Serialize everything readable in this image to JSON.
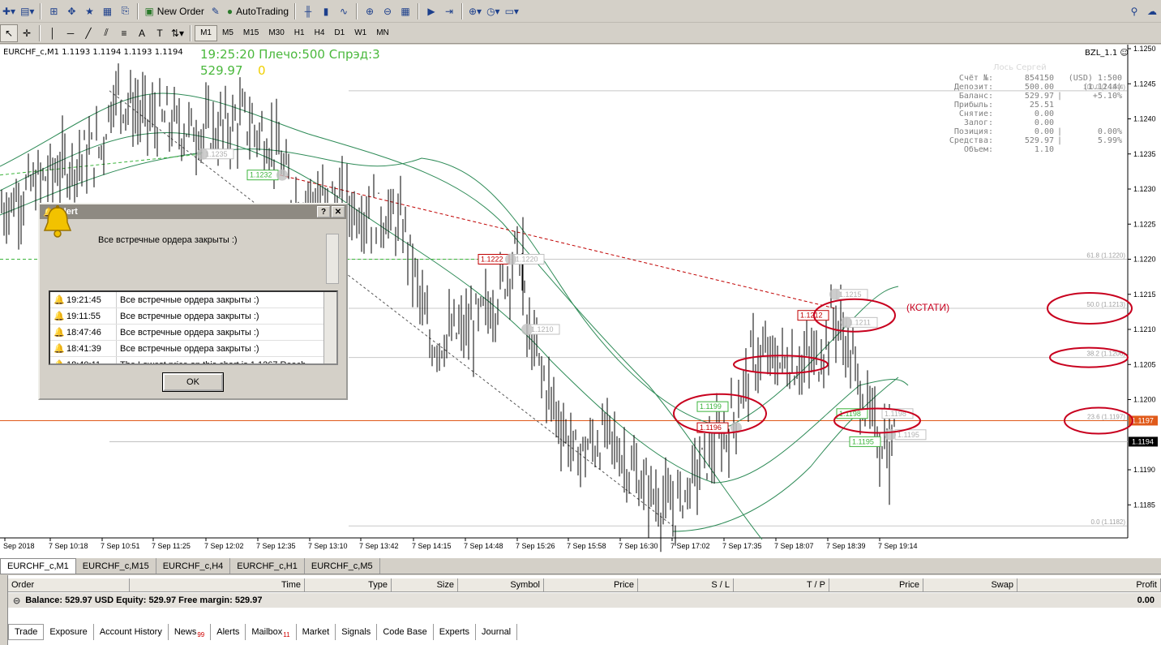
{
  "toolbar": {
    "new_order": "New Order",
    "autotrading": "AutoTrading",
    "timeframes": [
      "M1",
      "M5",
      "M15",
      "M30",
      "H1",
      "H4",
      "D1",
      "W1",
      "MN"
    ],
    "active_timeframe": "M1"
  },
  "chart": {
    "title": "EURCHF_c,M1  1.1193 1.1194 1.1193 1.1194",
    "clock_line": "19:25:20 Плечо:500 Спрэд:3",
    "balance_big": "529.97",
    "zero_big": "0",
    "indicator": "BZL_1.1",
    "annotation": "(КСТАТИ)",
    "price_labels": [
      "1.1250",
      "1.1245",
      "1.1240",
      "1.1235",
      "1.1230",
      "1.1225",
      "1.1220",
      "1.1215",
      "1.1210",
      "1.1205",
      "1.1200",
      "1.1197",
      "1.1194",
      "1.1190",
      "1.1185"
    ],
    "time_labels": [
      "Sep 2018",
      "7 Sep 10:18",
      "7 Sep 10:51",
      "7 Sep 11:25",
      "7 Sep 12:02",
      "7 Sep 12:35",
      "7 Sep 13:10",
      "7 Sep 13:42",
      "7 Sep 14:15",
      "7 Sep 14:48",
      "7 Sep 15:26",
      "7 Sep 15:58",
      "7 Sep 16:30",
      "7 Sep 17:02",
      "7 Sep 17:35",
      "7 Sep 18:07",
      "7 Sep 18:39",
      "7 Sep 19:14"
    ],
    "fib_labels": [
      "100.0 (1.1244)",
      "61.8 (1.1220)",
      "50.0 (1.1213)",
      "38.2 (1.1206)",
      "23.6 (1.1197)",
      "0.0 (1.1182)"
    ],
    "order_labels": [
      "1.1235",
      "1.1232",
      "1.1222",
      "1.1220",
      "1.1210",
      "1.1215",
      "1.1212",
      "1.1211",
      "1.1199",
      "1.1196",
      "1.1198",
      "1.1198",
      "1.1195",
      "1.1195"
    ]
  },
  "account": {
    "owner": "Лось Сергей",
    "rows": [
      {
        "k": "Счёт №:",
        "v": "854150",
        "s": "",
        "p": "(USD) 1:500"
      },
      {
        "k": "Депозит:",
        "v": "500.00",
        "s": "",
        "p": "(1.1244)"
      },
      {
        "k": "Баланс:",
        "v": "529.97",
        "s": "|",
        "p": "+5.10%"
      },
      {
        "k": "Прибыль:",
        "v": "25.51",
        "s": "",
        "p": ""
      },
      {
        "k": "Снятие:",
        "v": "0.00",
        "s": "",
        "p": ""
      },
      {
        "k": "Залог:",
        "v": "0.00",
        "s": "",
        "p": ""
      },
      {
        "k": "Позиция:",
        "v": "0.00",
        "s": "|",
        "p": "0.00%"
      },
      {
        "k": "Средства:",
        "v": "529.97",
        "s": "|",
        "p": "5.99%"
      },
      {
        "k": "Объем:",
        "v": "1.10",
        "s": "",
        "p": ""
      }
    ]
  },
  "alert": {
    "title": "Alert",
    "message": "Все встречные ордера закрыты :)",
    "rows": [
      {
        "time": "19:21:45",
        "msg": "Все встречные ордера закрыты :)"
      },
      {
        "time": "19:11:55",
        "msg": "Все встречные ордера закрыты :)"
      },
      {
        "time": "18:47:46",
        "msg": "Все встречные ордера закрыты :)"
      },
      {
        "time": "18:41:39",
        "msg": "Все встречные ордера закрыты :)"
      },
      {
        "time": "18:40:11",
        "msg": "The Lowest price on this chart is 1.1267 Reach"
      }
    ],
    "ok": "OK"
  },
  "chart_tabs": [
    "EURCHF_c,M1",
    "EURCHF_c,M15",
    "EURCHF_c,H4",
    "EURCHF_c,H1",
    "EURCHF_c,M5"
  ],
  "terminal": {
    "columns": [
      "Order",
      "Time",
      "Type",
      "Size",
      "Symbol",
      "Price",
      "S / L",
      "T / P",
      "Price",
      "Swap",
      "Profit"
    ],
    "balance_line": "Balance: 529.97 USD  Equity: 529.97  Free margin: 529.97",
    "profit": "0.00",
    "tabs": [
      {
        "label": "Trade",
        "badge": ""
      },
      {
        "label": "Exposure",
        "badge": ""
      },
      {
        "label": "Account History",
        "badge": ""
      },
      {
        "label": "News",
        "badge": "99"
      },
      {
        "label": "Alerts",
        "badge": ""
      },
      {
        "label": "Mailbox",
        "badge": "11"
      },
      {
        "label": "Market",
        "badge": ""
      },
      {
        "label": "Signals",
        "badge": ""
      },
      {
        "label": "Code Base",
        "badge": ""
      },
      {
        "label": "Experts",
        "badge": ""
      },
      {
        "label": "Journal",
        "badge": ""
      }
    ]
  },
  "colors": {
    "bull_green": "#4ab83c",
    "annotation_red": "#c8001e",
    "current_price_line": "#e05a1a"
  }
}
